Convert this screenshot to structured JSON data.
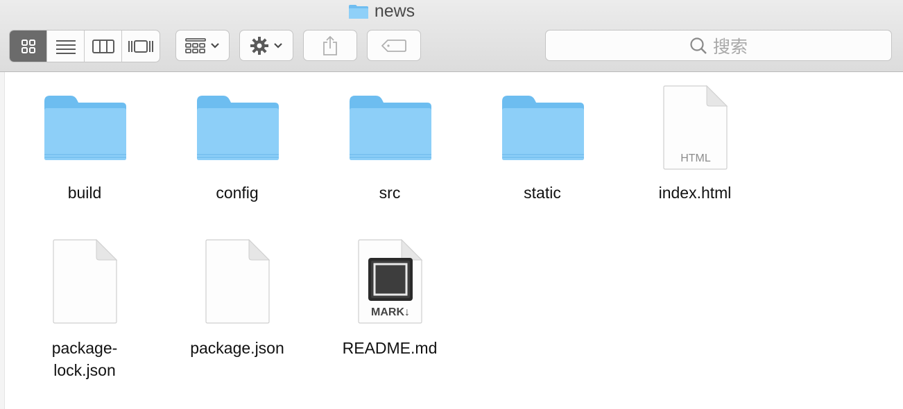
{
  "window": {
    "title": "news"
  },
  "toolbar": {
    "view_modes": [
      "icon-view",
      "list-view",
      "column-view",
      "gallery-view"
    ],
    "active_view": "icon-view",
    "search": {
      "placeholder": "搜索"
    }
  },
  "files": [
    {
      "name": "build",
      "kind": "folder"
    },
    {
      "name": "config",
      "kind": "folder"
    },
    {
      "name": "src",
      "kind": "folder"
    },
    {
      "name": "static",
      "kind": "folder"
    },
    {
      "name": "index.html",
      "kind": "document",
      "badge": "HTML"
    },
    {
      "name_lines": [
        "package-",
        "lock.json"
      ],
      "kind": "document"
    },
    {
      "name": "package.json",
      "kind": "document"
    },
    {
      "name": "README.md",
      "kind": "markdown",
      "badge": "MARK↓"
    }
  ],
  "colors": {
    "folder": "#7fc8f5",
    "toolbar": "#e4e4e4",
    "active_segment": "#6b6b6b"
  }
}
